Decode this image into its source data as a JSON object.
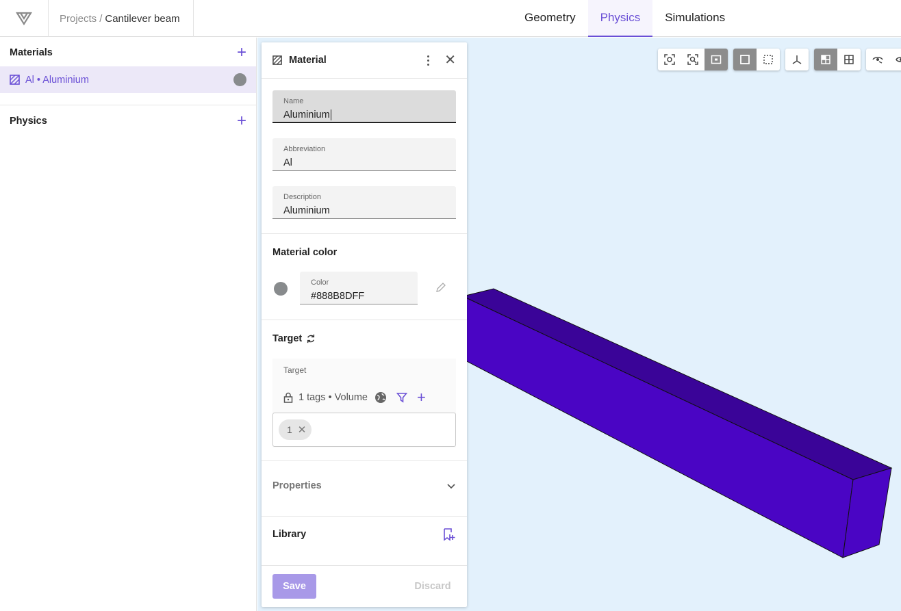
{
  "header": {
    "breadcrumb_root": "Projects",
    "breadcrumb_sep": "/",
    "breadcrumb_current": "Cantilever beam",
    "tabs": [
      {
        "label": "Geometry"
      },
      {
        "label": "Physics"
      },
      {
        "label": "Simulations"
      }
    ],
    "active_tab": "Physics"
  },
  "sidebar": {
    "materials_title": "Materials",
    "material_item": "Al • Aluminium",
    "physics_title": "Physics"
  },
  "panel": {
    "title": "Material",
    "name_label": "Name",
    "name_value": "Aluminium",
    "abbr_label": "Abbreviation",
    "abbr_value": "Al",
    "desc_label": "Description",
    "desc_value": "Aluminium",
    "color_section": "Material color",
    "color_label": "Color",
    "color_value": "#888B8DFF",
    "target_section": "Target",
    "target_label": "Target",
    "target_summary": "1 tags • Volume",
    "tag_chip": "1",
    "properties_label": "Properties",
    "library_label": "Library",
    "save_label": "Save",
    "discard_label": "Discard"
  },
  "colors": {
    "accent": "#6a4fd6",
    "material": "#888B8D",
    "beam": "#4a05c4",
    "viewport_bg": "#e3f1fc"
  }
}
